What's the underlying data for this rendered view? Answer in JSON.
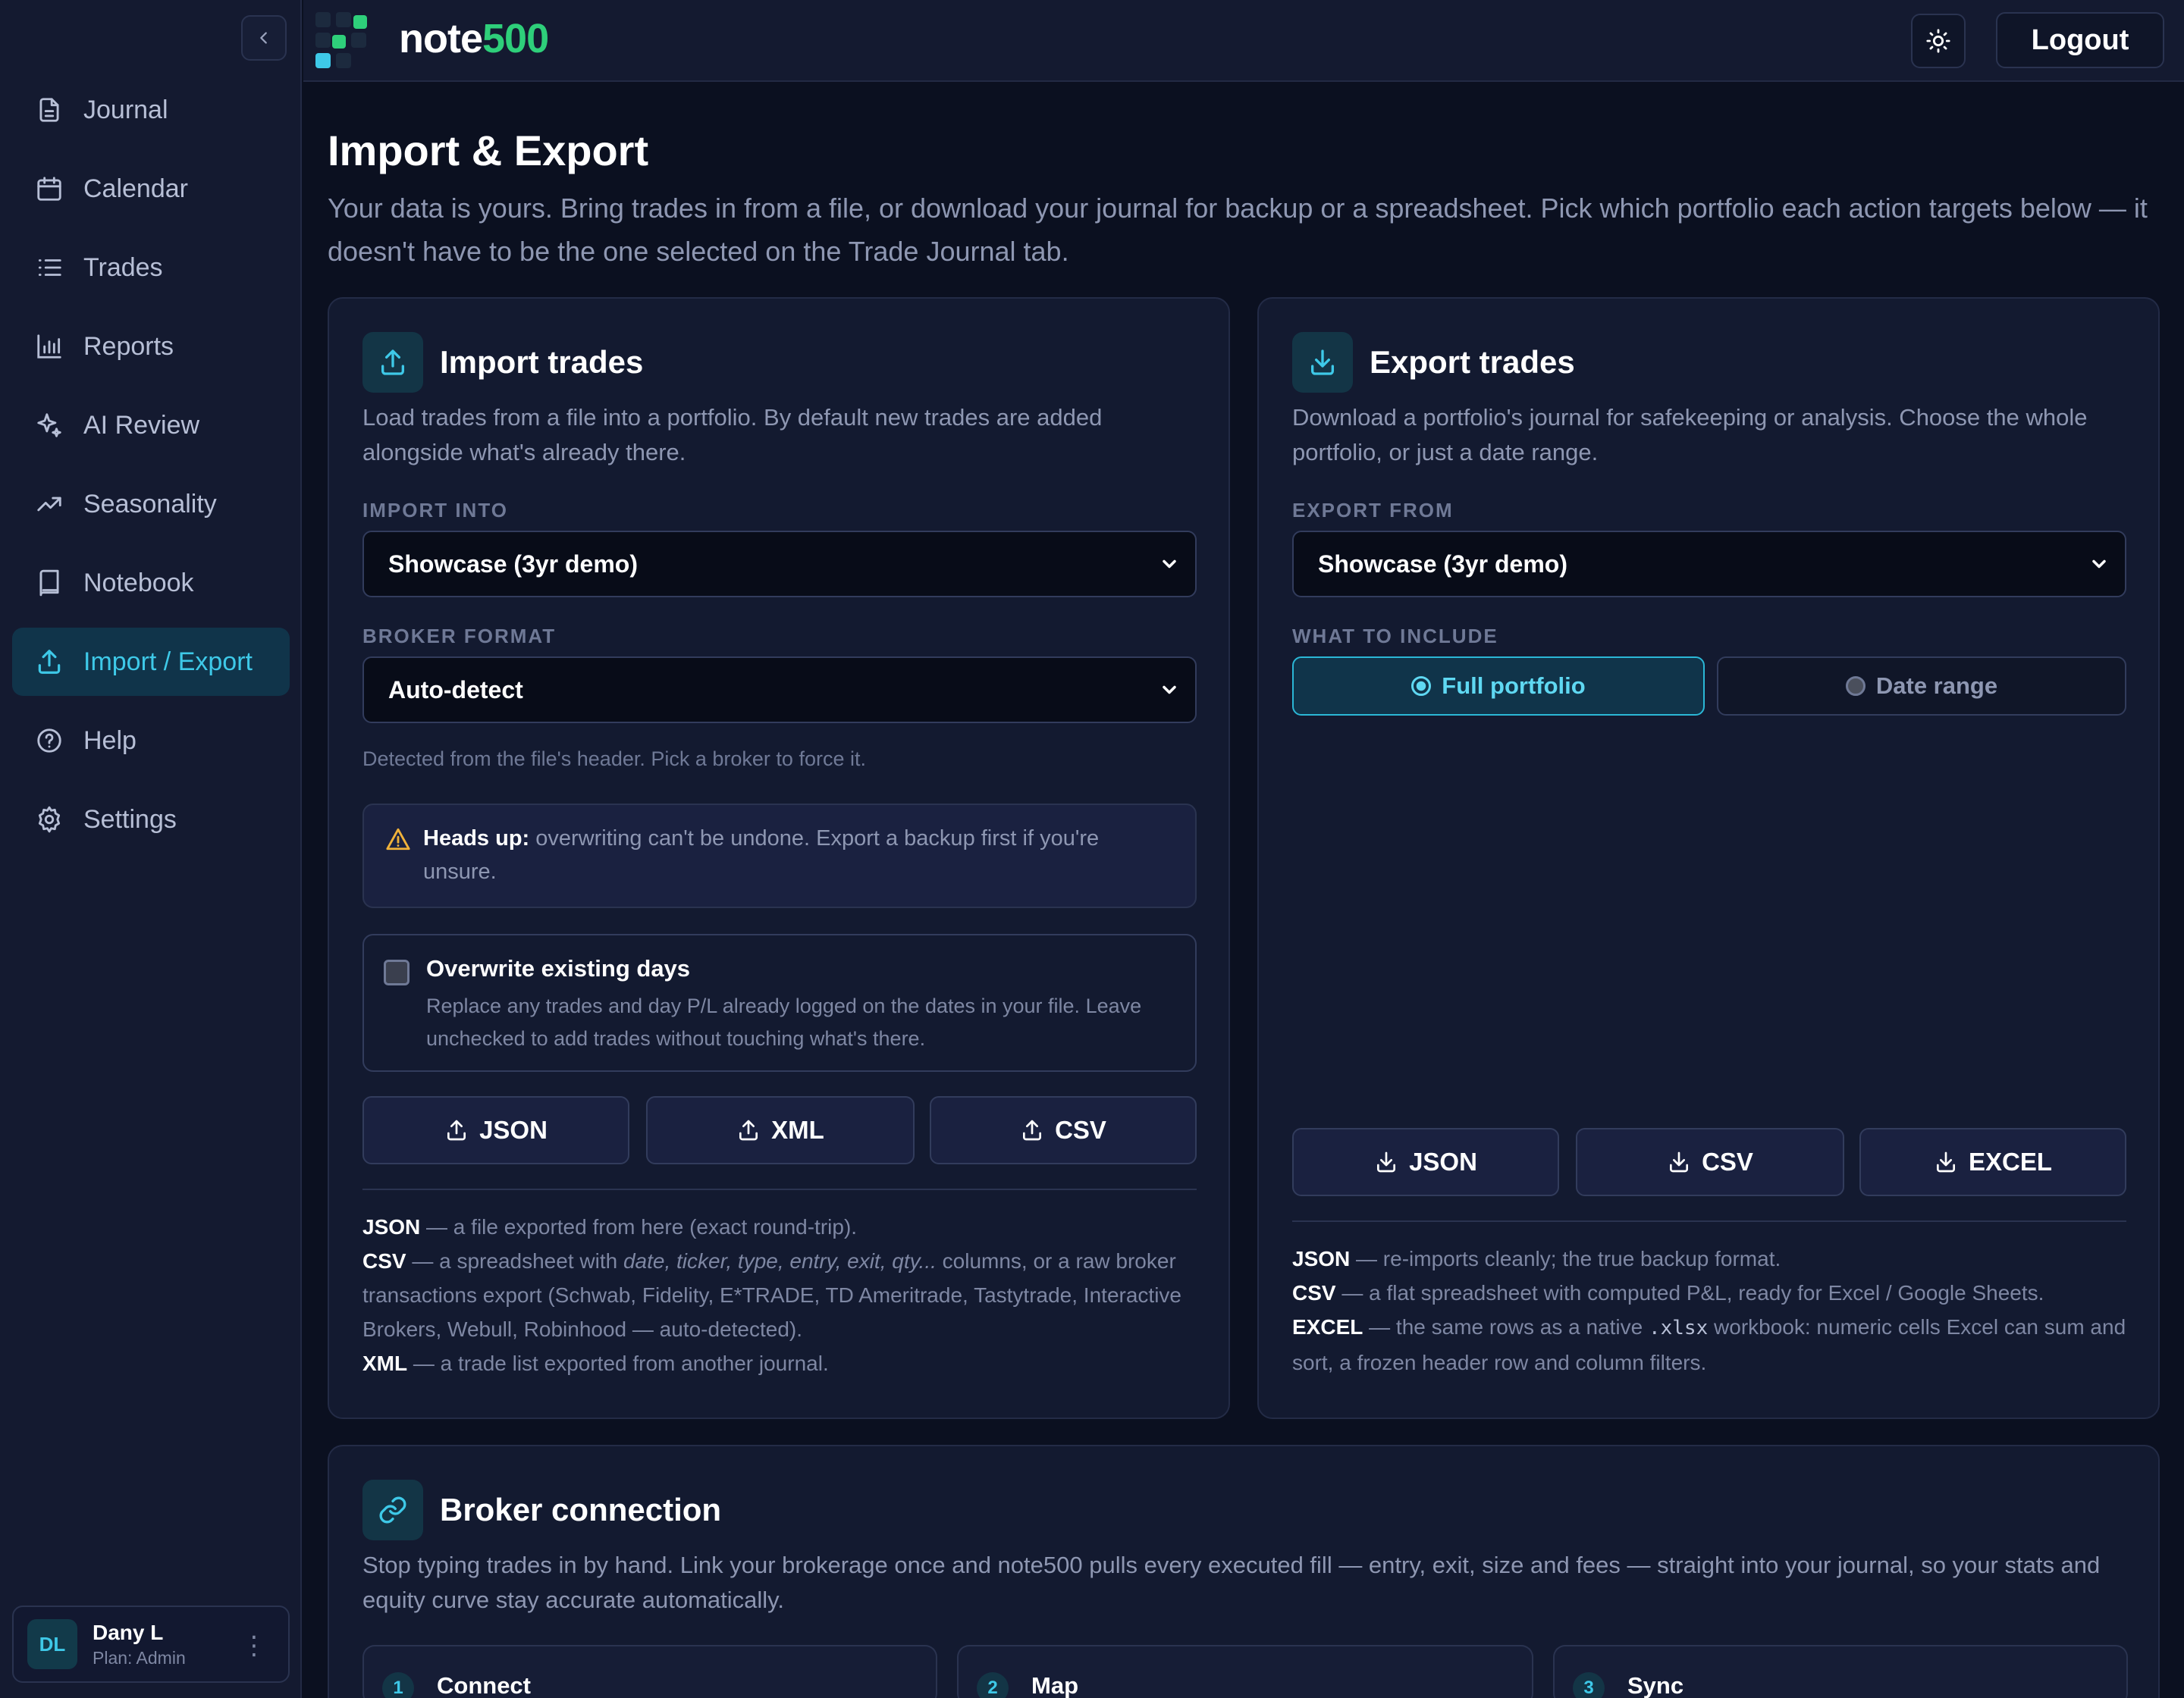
{
  "app": {
    "brand_a": "note",
    "brand_b": "500"
  },
  "topbar": {
    "logout_label": "Logout"
  },
  "sidebar": {
    "items": [
      {
        "label": "Journal",
        "icon": "file-icon"
      },
      {
        "label": "Calendar",
        "icon": "calendar-icon"
      },
      {
        "label": "Trades",
        "icon": "list-icon"
      },
      {
        "label": "Reports",
        "icon": "bar-chart-icon"
      },
      {
        "label": "AI Review",
        "icon": "sparkle-icon"
      },
      {
        "label": "Seasonality",
        "icon": "trend-icon"
      },
      {
        "label": "Notebook",
        "icon": "book-icon"
      },
      {
        "label": "Import / Export",
        "icon": "upload-icon",
        "active": true
      },
      {
        "label": "Help",
        "icon": "help-icon"
      },
      {
        "label": "Settings",
        "icon": "gear-icon"
      }
    ]
  },
  "user": {
    "initials": "DL",
    "name": "Dany L",
    "plan": "Plan: Admin"
  },
  "page": {
    "title": "Import & Export",
    "description": "Your data is yours. Bring trades in from a file, or download your journal for backup or a spreadsheet. Pick which portfolio each action targets below — it doesn't have to be the one selected on the Trade Journal tab."
  },
  "import": {
    "title": "Import trades",
    "description": "Load trades from a file into a portfolio. By default new trades are added alongside what's already there.",
    "into_label": "IMPORT INTO",
    "into_value": "Showcase (3yr demo)",
    "format_label": "BROKER FORMAT",
    "format_value": "Auto-detect",
    "format_hint": "Detected from the file's header. Pick a broker to force it.",
    "warning_bold": "Heads up:",
    "warning_text": " overwriting can't be undone. Export a backup first if you're unsure.",
    "overwrite_title": "Overwrite existing days",
    "overwrite_desc": "Replace any trades and day P/L already logged on the dates in your file. Leave unchecked to add trades without touching what's there.",
    "buttons": [
      "JSON",
      "XML",
      "CSV"
    ],
    "notes": {
      "json_b": "JSON",
      "json_t": " — a file exported from here (exact round-trip).",
      "csv_b": "CSV",
      "csv_t1": " — a spreadsheet with ",
      "csv_i": "date, ticker, type, entry, exit, qty...",
      "csv_t2": " columns, or a raw broker transactions export (Schwab, Fidelity, E*TRADE, TD Ameritrade, Tastytrade, Interactive Brokers, Webull, Robinhood — auto-detected).",
      "xml_b": "XML",
      "xml_t": " — a trade list exported from another journal."
    }
  },
  "export": {
    "title": "Export trades",
    "description": "Download a portfolio's journal for safekeeping or analysis. Choose the whole portfolio, or just a date range.",
    "from_label": "EXPORT FROM",
    "from_value": "Showcase (3yr demo)",
    "include_label": "WHAT TO INCLUDE",
    "opt_full": "Full portfolio",
    "opt_range": "Date range",
    "buttons": [
      "JSON",
      "CSV",
      "EXCEL"
    ],
    "notes": {
      "json_b": "JSON",
      "json_t": " — re-imports cleanly; the true backup format.",
      "csv_b": "CSV",
      "csv_t": " — a flat spreadsheet with computed P&L, ready for Excel / Google Sheets.",
      "excel_b": "EXCEL",
      "excel_t1": " — the same rows as a native ",
      "excel_code": ".xlsx",
      "excel_t2": " workbook: numeric cells Excel can sum and sort, a frozen header row and column filters."
    }
  },
  "broker": {
    "title": "Broker connection",
    "description": "Stop typing trades in by hand. Link your brokerage once and note500 pulls every executed fill — entry, exit, size and fees — straight into your journal, so your stats and equity curve stay accurate automatically.",
    "steps": [
      {
        "num": "1",
        "title": "Connect"
      },
      {
        "num": "2",
        "title": "Map"
      },
      {
        "num": "3",
        "title": "Sync"
      }
    ]
  },
  "colors": {
    "accent": "#3ec9e8",
    "brand_green": "#2ecf7a",
    "warning": "#f0b23a"
  }
}
